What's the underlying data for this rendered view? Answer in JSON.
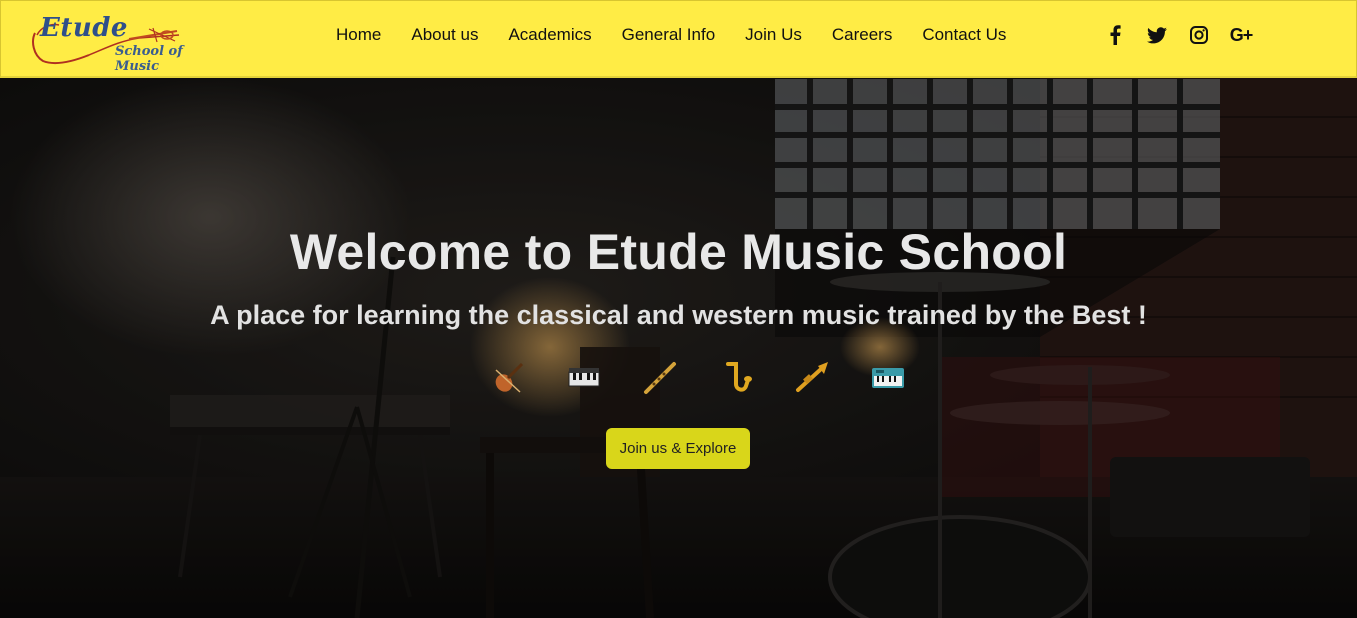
{
  "brand": {
    "logo_word": "Etude",
    "logo_sub": "School of Music"
  },
  "nav": {
    "items": [
      {
        "label": "Home"
      },
      {
        "label": "About us"
      },
      {
        "label": "Academics"
      },
      {
        "label": "General Info"
      },
      {
        "label": "Join Us"
      },
      {
        "label": "Careers"
      },
      {
        "label": "Contact Us"
      }
    ]
  },
  "social": {
    "icons": [
      "facebook-icon",
      "twitter-icon",
      "instagram-icon",
      "google-plus-icon"
    ],
    "gplus_label": "G+"
  },
  "hero": {
    "title": "Welcome to Etude Music School",
    "subtitle": "A place for learning the classical and western music trained by the Best !",
    "instrument_icons": [
      "violin-icon",
      "piano-icon",
      "flute-icon",
      "saxophone-icon",
      "trumpet-icon",
      "keyboard-icon"
    ],
    "cta_label": "Join us & Explore"
  },
  "colors": {
    "navbar_bg": "#ffec45",
    "cta_bg": "#d9d61a",
    "logo_blue": "#2f4f8a",
    "logo_red": "#b03020"
  }
}
